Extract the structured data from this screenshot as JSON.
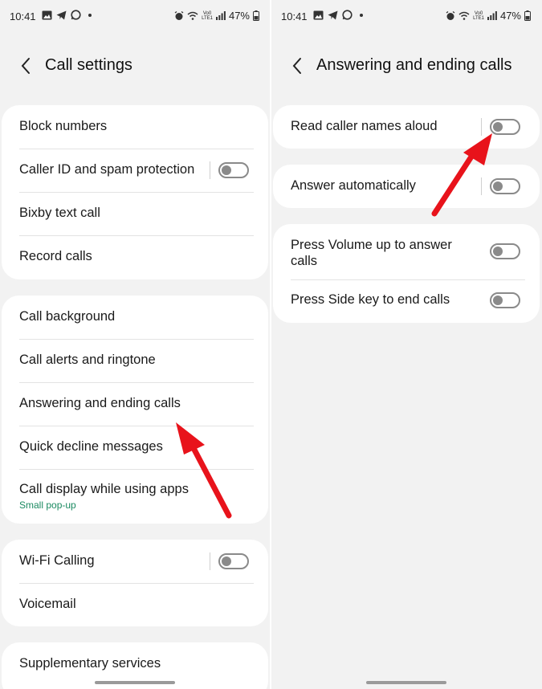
{
  "status_bar": {
    "time": "10:41",
    "network_label_top": "Vo0",
    "network_label_bottom": "LTE1",
    "battery": "47%"
  },
  "left_screen": {
    "title": "Call settings",
    "groups": [
      [
        {
          "label": "Block numbers",
          "toggle": false
        },
        {
          "label": "Caller ID and spam protection",
          "toggle": true
        },
        {
          "label": "Bixby text call",
          "toggle": false
        },
        {
          "label": "Record calls",
          "toggle": false
        }
      ],
      [
        {
          "label": "Call background"
        },
        {
          "label": "Call alerts and ringtone"
        },
        {
          "label": "Answering and ending calls"
        },
        {
          "label": "Quick decline messages"
        },
        {
          "label": "Call display while using apps",
          "sub": "Small pop-up"
        }
      ],
      [
        {
          "label": "Wi-Fi Calling",
          "toggle": true
        },
        {
          "label": "Voicemail"
        }
      ],
      [
        {
          "label": "Supplementary services"
        }
      ]
    ]
  },
  "right_screen": {
    "title": "Answering and ending calls",
    "groups": [
      [
        {
          "label": "Read caller names aloud",
          "toggle_on": false
        }
      ],
      [
        {
          "label": "Answer automatically",
          "toggle_on": false
        }
      ],
      [
        {
          "label": "Press Volume up to answer calls",
          "line1": "Press Volume up to answer",
          "line2": "calls",
          "toggle_on": false
        },
        {
          "label": "Press Side key to end calls",
          "toggle_on": false
        }
      ]
    ]
  },
  "colors": {
    "background": "#f2f2f2",
    "card": "#ffffff",
    "subtext_green": "#1b8a61",
    "arrow_red": "#e8131b",
    "toggle_off": "#8a8a8a"
  },
  "icons": [
    "back-arrow-icon",
    "gallery-icon",
    "telegram-icon",
    "whatsapp-icon",
    "alarm-icon",
    "wifi-icon",
    "signal-icon",
    "battery-icon"
  ]
}
